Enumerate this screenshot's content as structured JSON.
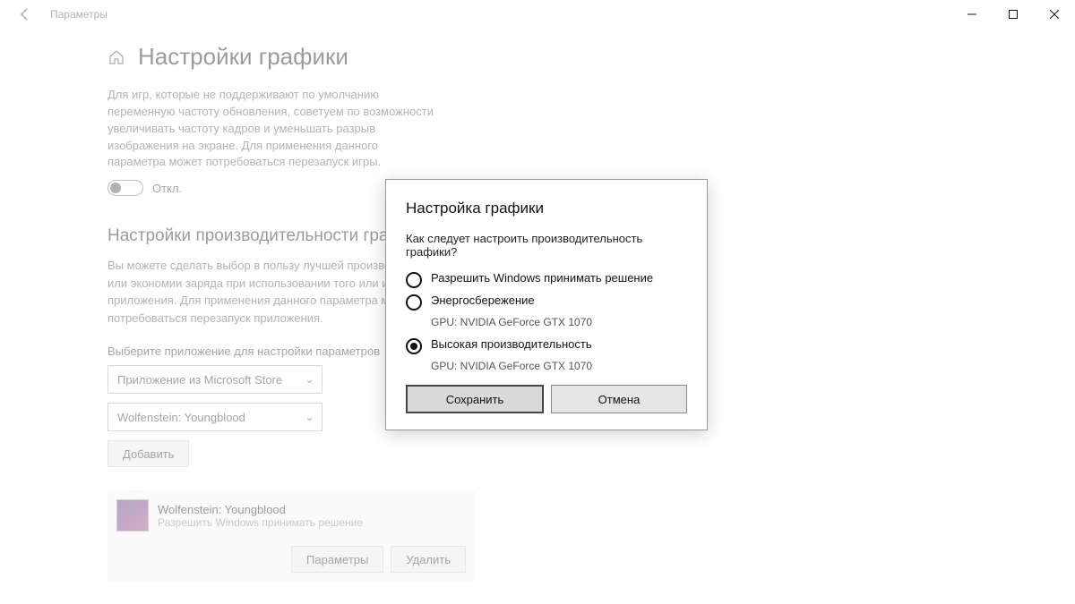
{
  "window": {
    "title": "Параметры"
  },
  "page": {
    "heading": "Настройки графики",
    "intro": "Для игр, которые не поддерживают по умолчанию переменную частоту обновления, советуем по возможности увеличивать частоту кадров и уменьшать разрыв изображения на экране. Для применения данного параметра может потребоваться перезапуск игры.",
    "toggle_label": "Откл.",
    "section_title": "Настройки производительности графики",
    "section_desc": "Вы можете сделать выбор в пользу лучшей производительности или экономии заряда при использовании того или иного приложения. Для применения данного параметра может потребоваться перезапуск приложения.",
    "picker_label": "Выберите приложение для настройки параметров",
    "combo1": "Приложение из Microsoft Store",
    "combo2": "Wolfenstein: Youngblood",
    "add_btn": "Добавить",
    "app_card": {
      "name": "Wolfenstein: Youngblood",
      "sub": "Разрешить Windows принимать решение",
      "options_btn": "Параметры",
      "remove_btn": "Удалить"
    }
  },
  "dialog": {
    "title": "Настройка графики",
    "question": "Как следует настроить производительность графики?",
    "options": [
      {
        "label": "Разрешить Windows принимать решение",
        "sub": "",
        "selected": false
      },
      {
        "label": "Энергосбережение",
        "sub": "GPU: NVIDIA GeForce GTX 1070",
        "selected": false
      },
      {
        "label": "Высокая производительность",
        "sub": "GPU: NVIDIA GeForce GTX 1070",
        "selected": true
      }
    ],
    "save": "Сохранить",
    "cancel": "Отмена"
  }
}
